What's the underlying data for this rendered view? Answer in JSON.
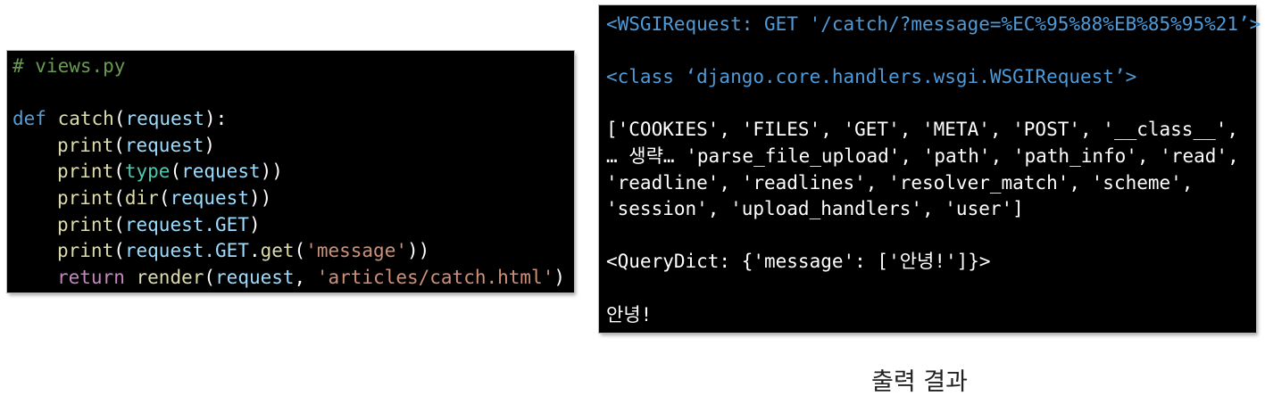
{
  "code": {
    "comment": "# views.py",
    "def_keyword": "def",
    "func_name": "catch",
    "param": "request",
    "print": "print",
    "type": "type",
    "dir": "dir",
    "request_get": "request.GET",
    "get_method": "get",
    "message_str": "'message'",
    "return_keyword": "return",
    "render": "render",
    "template_str": "'articles/catch.html'"
  },
  "output": {
    "line1": "<WSGIRequest: GET '/catch/?message=%EC%95%88%EB%85%95%21’>",
    "line2": "<class ‘django.core.handlers.wsgi.WSGIRequest’>",
    "line3": "['COOKIES', 'FILES', 'GET', 'META', 'POST', '__class__',",
    "line4": "… 생략… 'parse_file_upload', 'path', 'path_info', 'read',",
    "line5": "'readline', 'readlines', 'resolver_match', 'scheme',",
    "line6": "'session', 'upload_handlers', 'user']",
    "line7": "<QueryDict: {'message': ['안녕!']}>",
    "line8": "안녕!"
  },
  "caption": "출력 결과",
  "colors": {
    "panel_background": "#000000",
    "comment": "#6a9955",
    "keyword": "#569cd6",
    "function": "#dcdcaa",
    "parameter": "#9cdcfe",
    "string": "#ce9178",
    "return": "#c586c0",
    "output_blue": "#4f9bd9"
  }
}
